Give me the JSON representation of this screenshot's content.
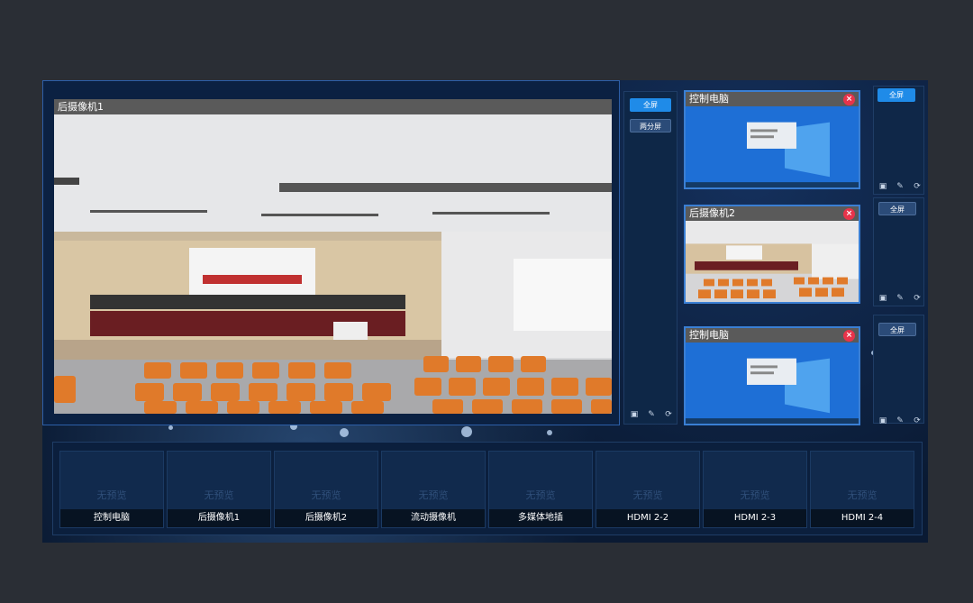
{
  "main": {
    "title": "后摄像机1"
  },
  "controls": {
    "fullscreen": "全屏",
    "split_two": "两分屏"
  },
  "previews": [
    {
      "title": "控制电脑",
      "kind": "desktop"
    },
    {
      "title": "后摄像机2",
      "kind": "camera"
    },
    {
      "title": "控制电脑",
      "kind": "desktop"
    }
  ],
  "right_slots": [
    {
      "fullscreen": "全屏"
    },
    {
      "fullscreen": "全屏"
    },
    {
      "fullscreen": "全屏"
    }
  ],
  "sources": [
    {
      "placeholder": "无预览",
      "label": "控制电脑"
    },
    {
      "placeholder": "无预览",
      "label": "后摄像机1"
    },
    {
      "placeholder": "无预览",
      "label": "后摄像机2"
    },
    {
      "placeholder": "无预览",
      "label": "流动摄像机"
    },
    {
      "placeholder": "无预览",
      "label": "多媒体地插"
    },
    {
      "placeholder": "无预览",
      "label": "HDMI 2-2"
    },
    {
      "placeholder": "无预览",
      "label": "HDMI 2-3"
    },
    {
      "placeholder": "无预览",
      "label": "HDMI 2-4"
    }
  ],
  "icons": {
    "save": "save-icon",
    "edit": "edit-icon",
    "refresh": "refresh-icon",
    "close": "close-icon"
  },
  "colors": {
    "accent": "#1f8be8",
    "close": "#e8334a",
    "frame": "#3a7fd4"
  }
}
